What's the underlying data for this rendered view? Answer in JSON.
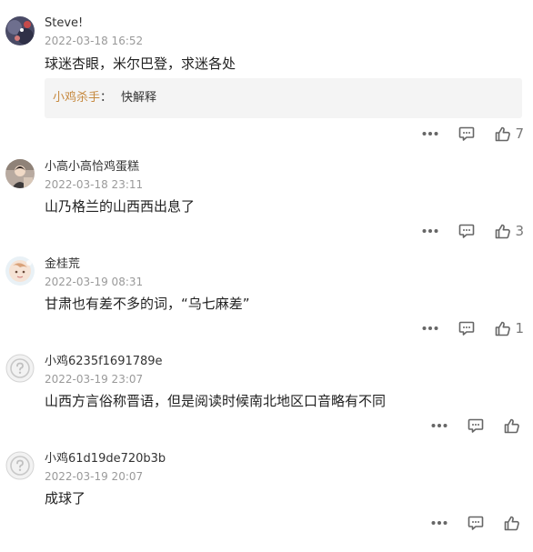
{
  "comments": [
    {
      "username": "Steve!",
      "timestamp": "2022-03-18 16:52",
      "content": "球迷杏眼，米尔巴登，求迷各处",
      "reply": {
        "author": "小鸡杀手",
        "separator": "：",
        "text": "快解释"
      },
      "likes": "7",
      "avatar_icon": "photo-avatar-dark"
    },
    {
      "username": "小高小高恰鸡蛋糕",
      "timestamp": "2022-03-18 23:11",
      "content": "山乃格兰的山西西出息了",
      "likes": "3",
      "avatar_icon": "photo-avatar-person"
    },
    {
      "username": "金桂荒",
      "timestamp": "2022-03-19 08:31",
      "content": "甘肃也有差不多的词，“乌七麻差”",
      "likes": "1",
      "avatar_icon": "photo-avatar-light"
    },
    {
      "username": "小鸡6235f1691789e",
      "timestamp": "2022-03-19 23:07",
      "content": "山西方言俗称晋语，但是阅读时候南北地区口音略有不同",
      "likes": "",
      "avatar_icon": "default-avatar-question"
    },
    {
      "username": "小鸡61d19de720b3b",
      "timestamp": "2022-03-19 20:07",
      "content": "成球了",
      "likes": "",
      "avatar_icon": "default-avatar-question"
    }
  ],
  "colors": {
    "reply_author": "#c6893f",
    "timestamp": "#9a9a9a",
    "icon": "#666666",
    "reply_bg": "#f4f4f4"
  },
  "icons": {
    "more": "more-dots-icon",
    "reply": "comment-bubble-icon",
    "like": "thumbs-up-icon"
  }
}
